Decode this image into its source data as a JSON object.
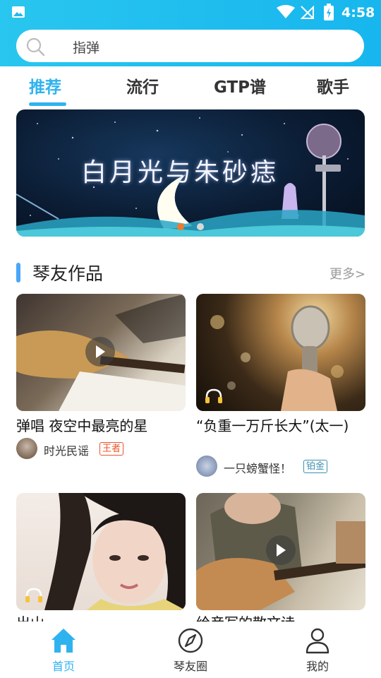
{
  "status_bar": {
    "time": "4:58"
  },
  "search": {
    "text": "指弹"
  },
  "tabs": [
    {
      "label": "推荐",
      "active": true
    },
    {
      "label": "流行",
      "active": false
    },
    {
      "label": "GTP谱",
      "active": false
    },
    {
      "label": "歌手",
      "active": false
    }
  ],
  "banner": {
    "title": "白月光与朱砂痣",
    "slide_count": 2,
    "active_slide": 1
  },
  "section": {
    "title": "琴友作品",
    "more": "更多>"
  },
  "cards": [
    {
      "title": "弹唱 夜空中最亮的星",
      "author": "时光民谣",
      "badge": "王者",
      "badge_color": "#e8542b",
      "media": "video"
    },
    {
      "title": "“负重一万斤长大”(太一)",
      "author": "一只螃蟹怪！",
      "badge": "铂金",
      "badge_color": "#3c8fb0",
      "media": "audio"
    },
    {
      "title": "出山",
      "author": "",
      "badge": "",
      "media": "audio"
    },
    {
      "title": "给彦写的散文诗",
      "author": "",
      "badge": "",
      "media": "video"
    }
  ],
  "bottom_nav": [
    {
      "label": "首页",
      "icon": "home-icon",
      "active": true
    },
    {
      "label": "琴友圈",
      "icon": "compass-icon",
      "active": false
    },
    {
      "label": "我的",
      "icon": "user-icon",
      "active": false
    }
  ],
  "colors": {
    "accent": "#2fb3ef",
    "header": "#1fbcef",
    "section_bar": "#4aa6f7"
  }
}
